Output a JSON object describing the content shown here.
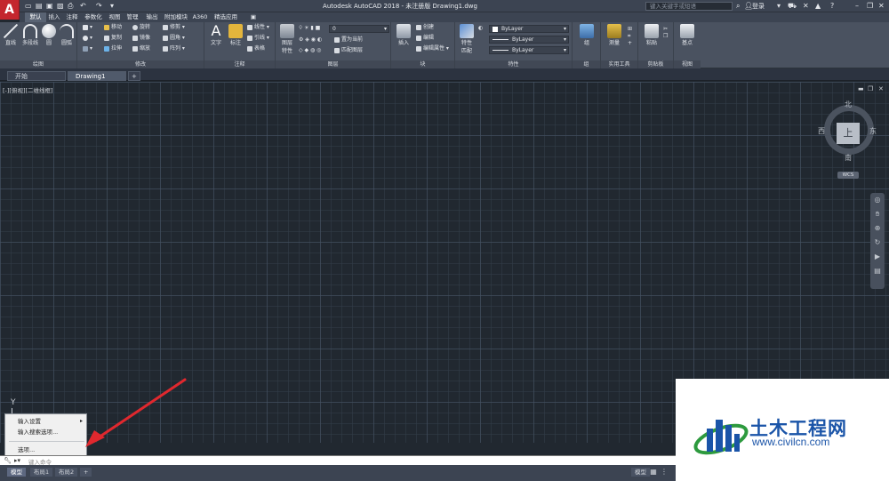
{
  "window": {
    "title": "Autodesk AutoCAD 2018 - 未注册版    Drawing1.dwg",
    "search_placeholder": "键入关键字或短语",
    "login_label": "登录",
    "app_button": "A"
  },
  "menu_tabs": [
    "默认",
    "插入",
    "注释",
    "参数化",
    "视图",
    "管理",
    "输出",
    "附加模块",
    "A360",
    "精选应用"
  ],
  "ribbon": {
    "draw": {
      "label": "绘图",
      "line": "直线",
      "polyline": "多段线",
      "circle": "圆",
      "arc": "圆弧"
    },
    "modify": {
      "label": "修改",
      "move": "移动",
      "rotate": "旋转",
      "trim": "修剪",
      "copy": "复制",
      "mirror": "镜像",
      "fillet": "圆角",
      "stretch": "拉伸",
      "scale": "缩放",
      "array": "阵列"
    },
    "annotation": {
      "label": "注释",
      "text": "文字",
      "dimension": "标注",
      "linear": "线性",
      "leader": "引线",
      "table": "表格"
    },
    "layers": {
      "label": "图层",
      "properties": "图层\n特性",
      "current_layer": "0",
      "make_current": "置为当前",
      "match_layer": "匹配图层"
    },
    "block": {
      "label": "块",
      "insert": "插入",
      "create": "创建",
      "edit": "编辑",
      "edit_attr": "编辑属性"
    },
    "properties": {
      "label": "特性",
      "match": "特性\n匹配",
      "color": "ByLayer",
      "linetype": "ByLayer",
      "lineweight": "ByLayer"
    },
    "groups": {
      "label": "组",
      "group": "组"
    },
    "utilities": {
      "label": "实用工具",
      "measure": "测量"
    },
    "clipboard": {
      "label": "剪贴板",
      "paste": "粘贴"
    },
    "view": {
      "label": "视图",
      "base": "基点"
    }
  },
  "file_tabs": [
    "开始",
    "Drawing1"
  ],
  "viewport": {
    "label": "[-][俯视][二维线框]"
  },
  "viewcube": {
    "north": "北",
    "south": "南",
    "east": "东",
    "west": "西",
    "top": "上",
    "wcs": "WCS"
  },
  "ucs": {
    "y_label": "Y"
  },
  "context_menu": {
    "items": [
      "输入设置",
      "输入搜索选项...",
      "选项..."
    ]
  },
  "command_line": {
    "placeholder": "键入命令"
  },
  "layout_tabs": [
    "模型",
    "布局1",
    "布局2"
  ],
  "status": {
    "model_label": "模型"
  },
  "watermark": {
    "brand": "土木工程网",
    "url": "www.civilcn.com"
  },
  "colors": {
    "accent": "#c4262e",
    "canvas": "#212830",
    "arrow": "#e0282e",
    "watermark_blue": "#1a54a8"
  }
}
